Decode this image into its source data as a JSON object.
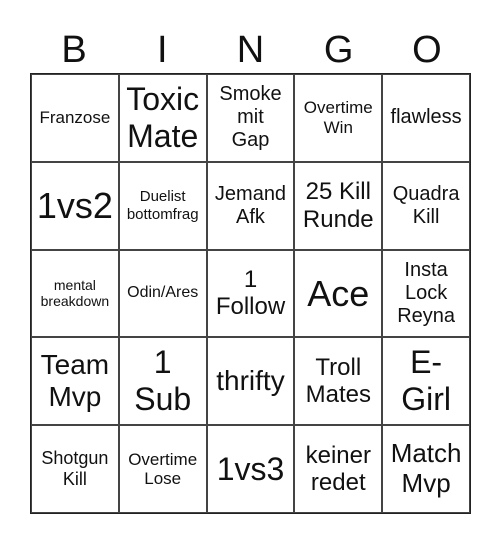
{
  "header": [
    "B",
    "I",
    "N",
    "G",
    "O"
  ],
  "cells": [
    "Franzose",
    "Toxic\nMate",
    "Smoke\nmit\nGap",
    "Overtime\nWin",
    "flawless",
    "1vs2",
    "Duelist\nbottomfrag",
    "Jemand\nAfk",
    "25 Kill\nRunde",
    "Quadra\nKill",
    "mental\nbreakdown",
    "Odin/Ares",
    "1\nFollow",
    "Ace",
    "Insta\nLock\nReyna",
    "Team\nMvp",
    "1\nSub",
    "thrifty",
    "Troll\nMates",
    "E-\nGirl",
    "Shotgun\nKill",
    "Overtime\nLose",
    "1vs3",
    "keiner\nredet",
    "Match\nMvp"
  ]
}
